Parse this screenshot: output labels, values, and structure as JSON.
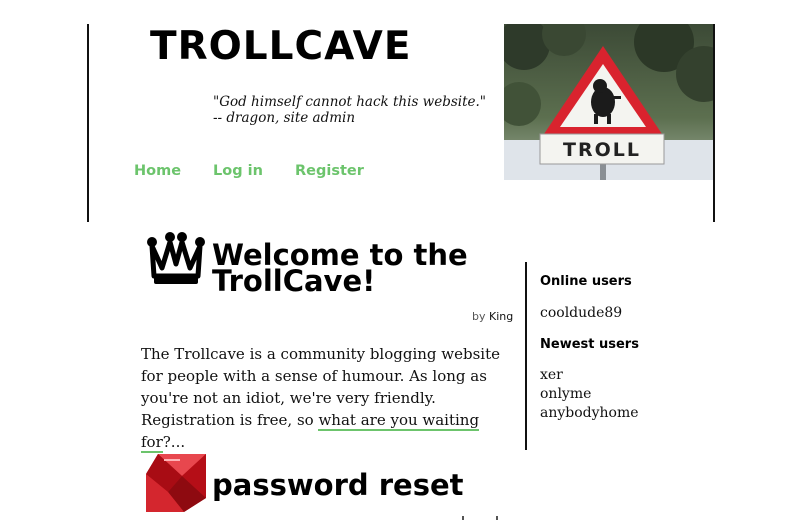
{
  "header": {
    "title": "TROLLCAVE",
    "tagline": "\"God himself cannot hack this website.\" -- dragon, site admin",
    "sign_text": "TROLL"
  },
  "nav": {
    "items": [
      {
        "label": "Home"
      },
      {
        "label": "Log in"
      },
      {
        "label": "Register"
      }
    ]
  },
  "posts": [
    {
      "icon": "crown-icon",
      "title": "Welcome to the TrollCave!",
      "byline_prefix": "by",
      "author": "King",
      "body_text": "The Trollcave is a community blogging website for people with a sense of humour. As long as you're not an idiot, we're very friendly. Registration is free, so ",
      "body_link": "what are you waiting for",
      "body_suffix": "?..."
    },
    {
      "icon": "ruby-icon",
      "title": "password reset"
    }
  ],
  "sidebar": {
    "online_title": "Online users",
    "online_users": [
      "cooldude89"
    ],
    "newest_title": "Newest users",
    "newest_users": [
      "xer",
      "onlyme",
      "anybodyhome"
    ]
  },
  "colors": {
    "link_green": "#6cc46c",
    "sign_red": "#d9232e",
    "ruby_red": "#c8101a"
  }
}
